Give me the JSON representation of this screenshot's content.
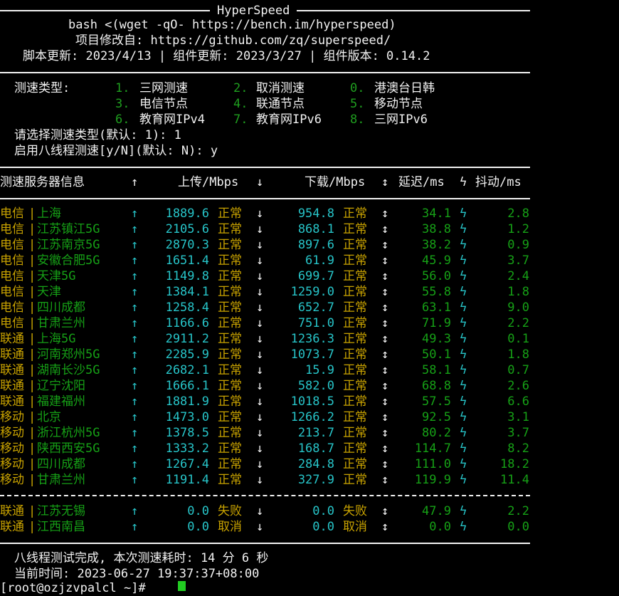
{
  "header": {
    "title": "HyperSpeed",
    "command": "bash <(wget -qO- https://bench.im/hyperspeed)",
    "source": "项目修改自: https://github.com/zq/superspeed/",
    "versions": "脚本更新: 2023/4/13 | 组件更新: 2023/3/27 | 组件版本: 0.14.2"
  },
  "menu": {
    "label": "测速类型:",
    "options": [
      {
        "num": "1.",
        "label": "三网测速"
      },
      {
        "num": "2.",
        "label": "取消测速"
      },
      {
        "num": "0.",
        "label": "港澳台日韩"
      },
      {
        "num": "3.",
        "label": "电信节点"
      },
      {
        "num": "4.",
        "label": "联通节点"
      },
      {
        "num": "5.",
        "label": "移动节点"
      },
      {
        "num": "6.",
        "label": "教育网IPv4"
      },
      {
        "num": "7.",
        "label": "教育网IPv6"
      },
      {
        "num": "8.",
        "label": "三网IPv6"
      }
    ],
    "prompt_type": "请选择测速类型(默认: 1): 1",
    "prompt_threads": "启用八线程测速[y/N](默认: N): y"
  },
  "table": {
    "headers": {
      "server": "测速服务器信息",
      "up_arrow": "↑",
      "upload": "上传/Mbps",
      "down_arrow": "↓",
      "download": "下载/Mbps",
      "latency_icon": "↕",
      "latency": "延迟/ms",
      "jitter_icon": "ϟ",
      "jitter": "抖动/ms"
    },
    "rows": [
      {
        "isp": "电信",
        "node": "上海",
        "upload": "1889.6",
        "upstat": "正常",
        "download": "954.8",
        "downstat": "正常",
        "latency": "34.1",
        "jitter": "2.8"
      },
      {
        "isp": "电信",
        "node": "江苏镇江5G",
        "upload": "2105.6",
        "upstat": "正常",
        "download": "868.1",
        "downstat": "正常",
        "latency": "38.8",
        "jitter": "1.2"
      },
      {
        "isp": "电信",
        "node": "江苏南京5G",
        "upload": "2870.3",
        "upstat": "正常",
        "download": "897.6",
        "downstat": "正常",
        "latency": "38.2",
        "jitter": "0.9"
      },
      {
        "isp": "电信",
        "node": "安徽合肥5G",
        "upload": "1651.4",
        "upstat": "正常",
        "download": "61.9",
        "downstat": "正常",
        "latency": "45.9",
        "jitter": "3.7"
      },
      {
        "isp": "电信",
        "node": "天津5G",
        "upload": "1149.8",
        "upstat": "正常",
        "download": "699.7",
        "downstat": "正常",
        "latency": "56.0",
        "jitter": "2.4"
      },
      {
        "isp": "电信",
        "node": "天津",
        "upload": "1384.1",
        "upstat": "正常",
        "download": "1259.0",
        "downstat": "正常",
        "latency": "55.8",
        "jitter": "1.8"
      },
      {
        "isp": "电信",
        "node": "四川成都",
        "upload": "1258.4",
        "upstat": "正常",
        "download": "652.7",
        "downstat": "正常",
        "latency": "63.1",
        "jitter": "9.0"
      },
      {
        "isp": "电信",
        "node": "甘肃兰州",
        "upload": "1166.6",
        "upstat": "正常",
        "download": "751.0",
        "downstat": "正常",
        "latency": "71.9",
        "jitter": "2.2"
      },
      {
        "isp": "联通",
        "node": "上海5G",
        "upload": "2911.2",
        "upstat": "正常",
        "download": "1236.3",
        "downstat": "正常",
        "latency": "49.3",
        "jitter": "0.1"
      },
      {
        "isp": "联通",
        "node": "河南郑州5G",
        "upload": "2285.9",
        "upstat": "正常",
        "download": "1073.7",
        "downstat": "正常",
        "latency": "50.1",
        "jitter": "1.8"
      },
      {
        "isp": "联通",
        "node": "湖南长沙5G",
        "upload": "2682.1",
        "upstat": "正常",
        "download": "15.9",
        "downstat": "正常",
        "latency": "58.1",
        "jitter": "0.7"
      },
      {
        "isp": "联通",
        "node": "辽宁沈阳",
        "upload": "1666.1",
        "upstat": "正常",
        "download": "582.0",
        "downstat": "正常",
        "latency": "68.8",
        "jitter": "2.6"
      },
      {
        "isp": "联通",
        "node": "福建福州",
        "upload": "1881.9",
        "upstat": "正常",
        "download": "1018.5",
        "downstat": "正常",
        "latency": "57.5",
        "jitter": "6.6"
      },
      {
        "isp": "移动",
        "node": "北京",
        "upload": "1473.0",
        "upstat": "正常",
        "download": "1266.2",
        "downstat": "正常",
        "latency": "92.5",
        "jitter": "3.1"
      },
      {
        "isp": "移动",
        "node": "浙江杭州5G",
        "upload": "1378.5",
        "upstat": "正常",
        "download": "213.7",
        "downstat": "正常",
        "latency": "80.2",
        "jitter": "3.7"
      },
      {
        "isp": "移动",
        "node": "陕西西安5G",
        "upload": "1333.2",
        "upstat": "正常",
        "download": "168.7",
        "downstat": "正常",
        "latency": "114.7",
        "jitter": "8.2"
      },
      {
        "isp": "移动",
        "node": "四川成都",
        "upload": "1267.4",
        "upstat": "正常",
        "download": "284.8",
        "downstat": "正常",
        "latency": "111.0",
        "jitter": "18.2"
      },
      {
        "isp": "移动",
        "node": "甘肃兰州",
        "upload": "1191.4",
        "upstat": "正常",
        "download": "327.9",
        "downstat": "正常",
        "latency": "119.9",
        "jitter": "11.4"
      }
    ],
    "failed_rows": [
      {
        "isp": "联通",
        "node": "江苏无锡",
        "upload": "0.0",
        "upstat": "失败",
        "download": "0.0",
        "downstat": "失败",
        "latency": "47.9",
        "jitter": "2.2"
      },
      {
        "isp": "联通",
        "node": "江西南昌",
        "upload": "0.0",
        "upstat": "取消",
        "download": "0.0",
        "downstat": "取消",
        "latency": "0.0",
        "jitter": "0.0"
      }
    ]
  },
  "footer": {
    "done": "八线程测试完成, 本次测速耗时: 14 分 6 秒",
    "time": "当前时间: 2023-06-27 19:37:37+08:00",
    "prompt": "[root@ozjzvpalcl ~]#"
  },
  "colors": {
    "background": "#000000",
    "text": "#f2f2f2",
    "green": "#1f9e1f",
    "yellow": "#c9a300",
    "cyan": "#27c4c8",
    "cursor": "#22cc22"
  }
}
